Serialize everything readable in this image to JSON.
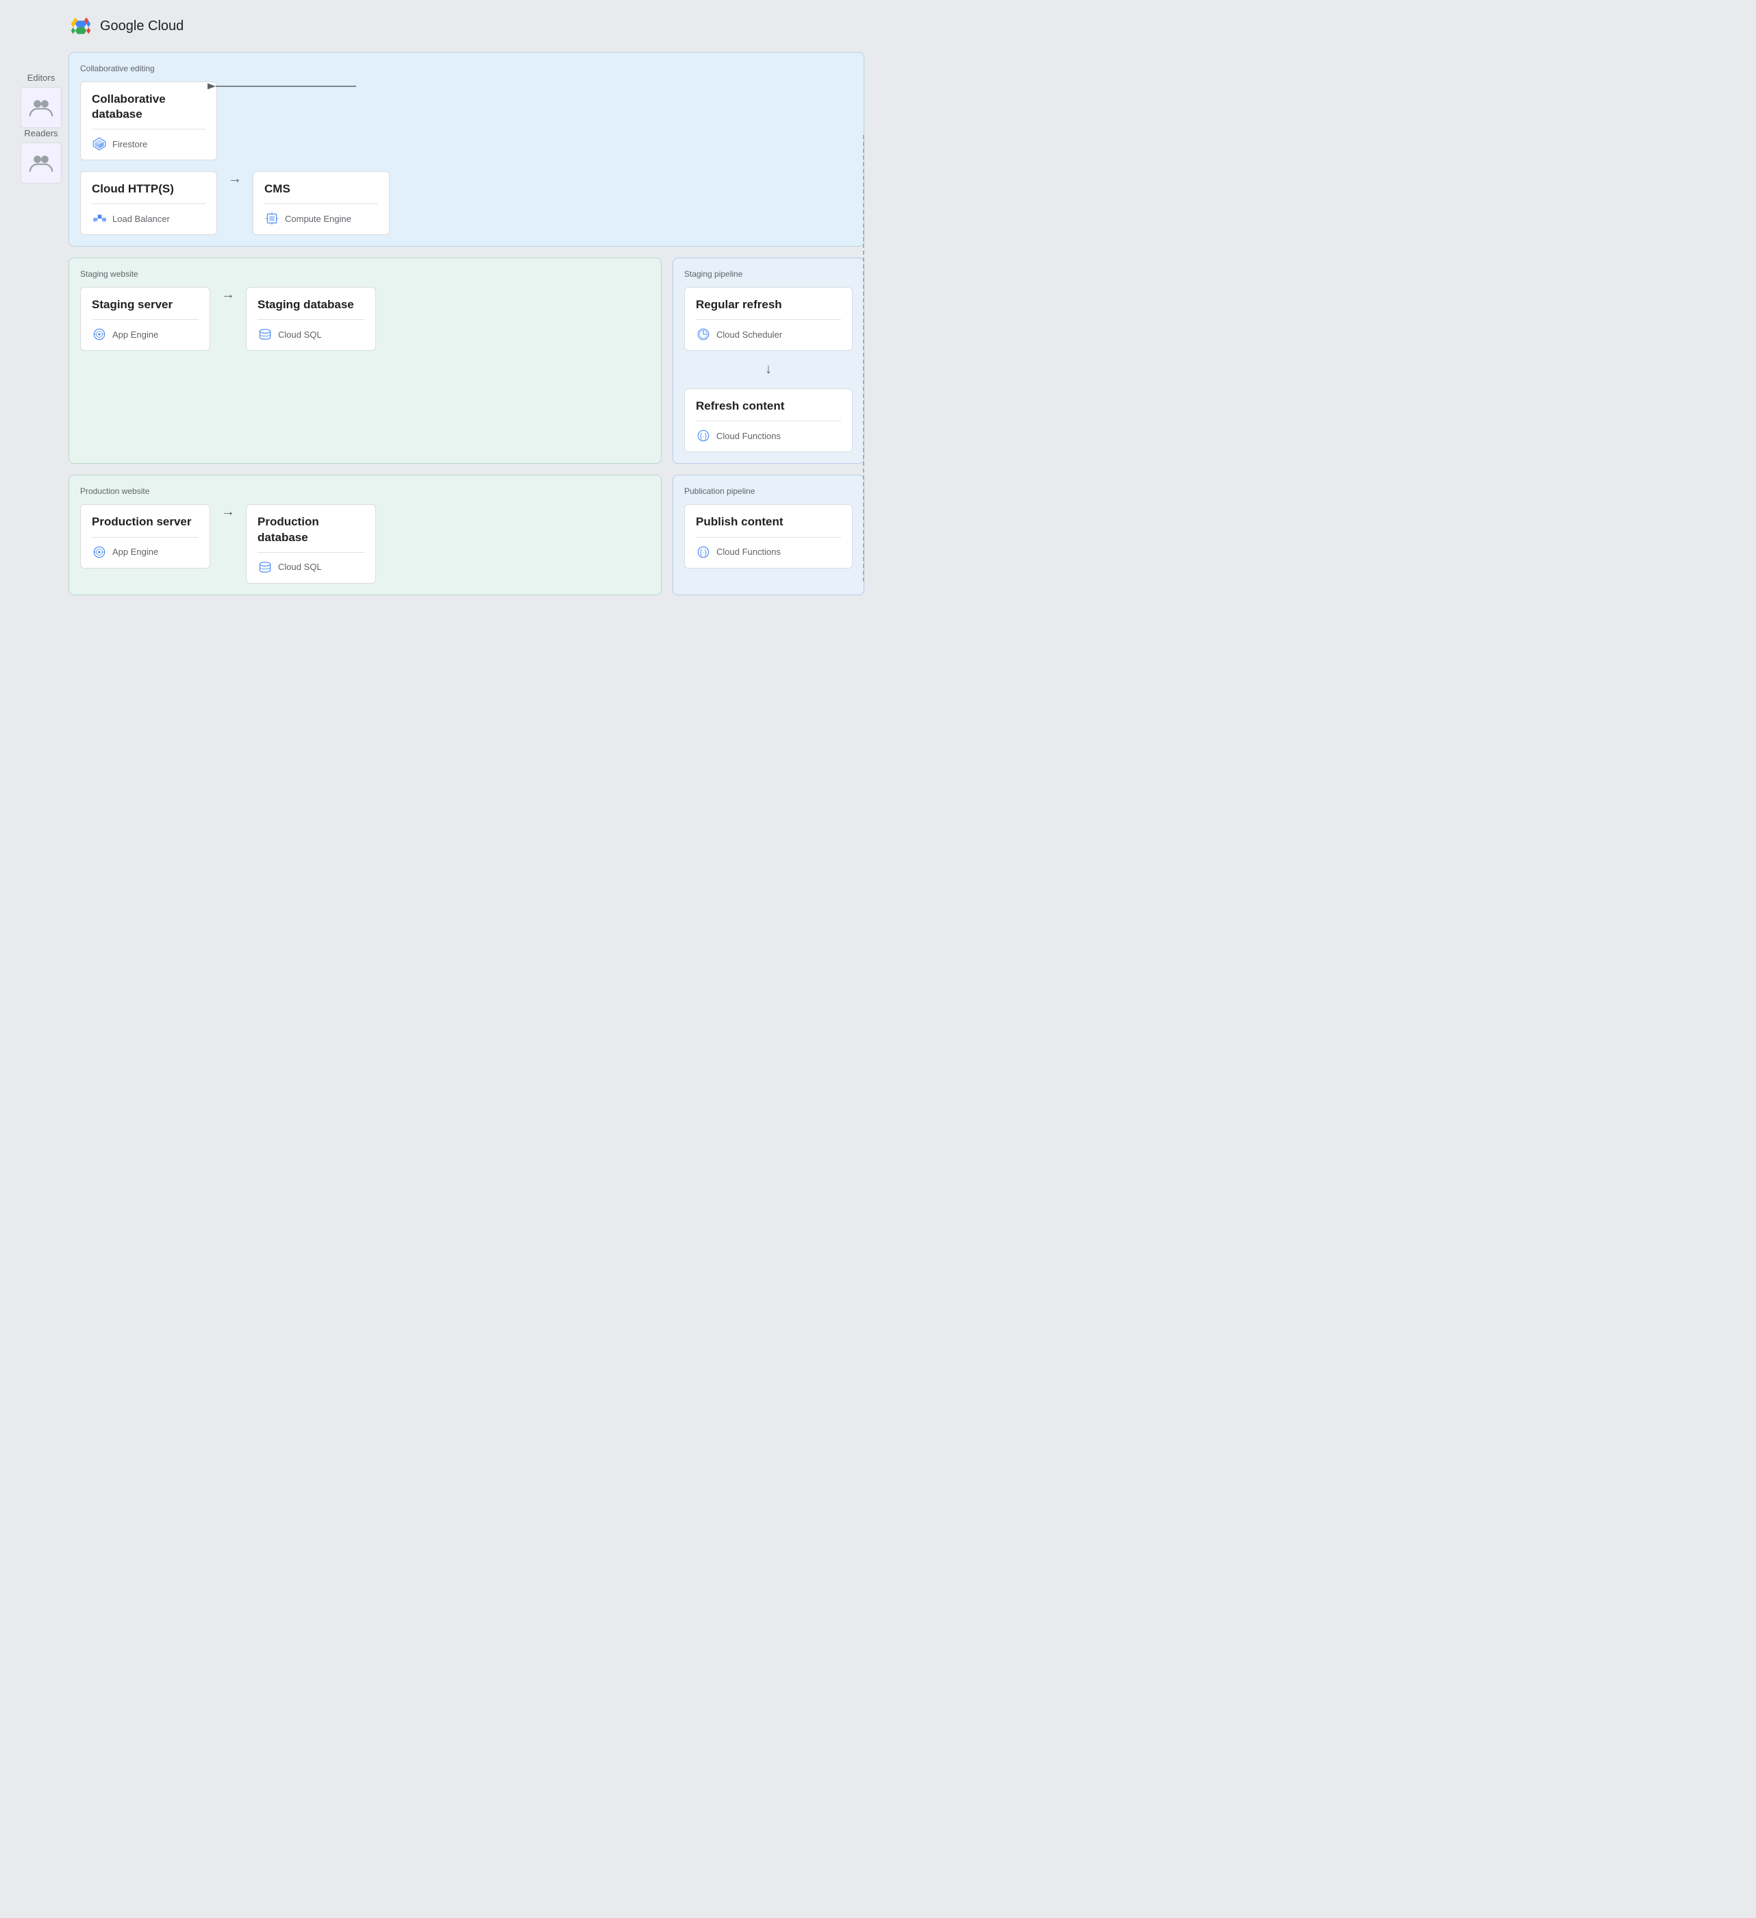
{
  "logo": {
    "alt": "Google Cloud",
    "text": "Google Cloud"
  },
  "actors": {
    "editors": {
      "label": "Editors",
      "icon": "people"
    },
    "readers": {
      "label": "Readers",
      "icon": "people"
    }
  },
  "sections": {
    "collaborative_editing": {
      "label": "Collaborative editing",
      "cards": {
        "collaborative_db": {
          "title": "Collaborative database",
          "service": "Firestore"
        },
        "cloud_https": {
          "title": "Cloud HTTP(S)",
          "service": "Load Balancer"
        },
        "cms": {
          "title": "CMS",
          "service": "Compute Engine"
        }
      }
    },
    "staging_website": {
      "label": "Staging website",
      "cards": {
        "staging_server": {
          "title": "Staging server",
          "service": "App Engine"
        },
        "staging_database": {
          "title": "Staging database",
          "service": "Cloud SQL"
        }
      }
    },
    "staging_pipeline": {
      "label": "Staging pipeline",
      "cards": {
        "regular_refresh": {
          "title": "Regular refresh",
          "service": "Cloud Scheduler"
        },
        "refresh_content": {
          "title": "Refresh content",
          "service": "Cloud Functions"
        }
      }
    },
    "production_website": {
      "label": "Production website",
      "cards": {
        "production_server": {
          "title": "Production server",
          "service": "App Engine"
        },
        "production_database": {
          "title": "Production database",
          "service": "Cloud SQL"
        }
      }
    },
    "publication_pipeline": {
      "label": "Publication pipeline",
      "cards": {
        "publish_content": {
          "title": "Publish content",
          "service": "Cloud Functions"
        }
      }
    }
  }
}
